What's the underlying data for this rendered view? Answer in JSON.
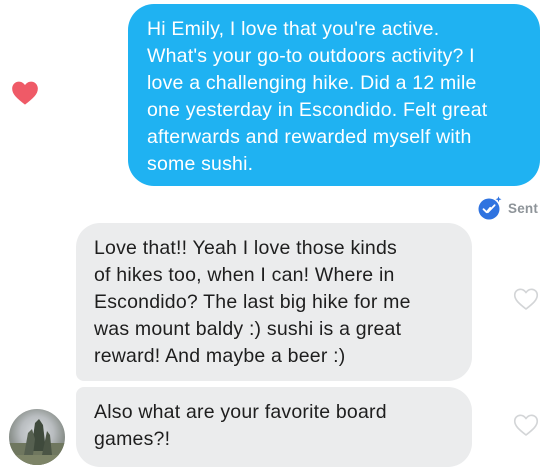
{
  "conversation": {
    "messages": [
      {
        "direction": "outgoing",
        "text": "Hi Emily, I love that you're active.\nWhat's your go-to outdoors activity? I\nlove a challenging hike. Did a 12 mile\none yesterday in Escondido. Felt great\nafterwards and rewarded myself with\nsome sushi.",
        "liked": true
      },
      {
        "direction": "incoming",
        "text": "Love that!! Yeah I love those kinds\nof hikes too, when I can! Where in\nEscondido? The last big hike for me\nwas mount baldy :) sushi is a great\nreward! And maybe a beer :)",
        "liked": false
      },
      {
        "direction": "incoming",
        "text": "Also what are your favorite board\ngames?!",
        "liked": false
      }
    ],
    "status": {
      "label": "Sent",
      "icon": "sent-check-icon"
    }
  },
  "icons": {
    "liked_heart": "heart-filled-icon",
    "like_button": "heart-outline-icon",
    "avatar": "profile-avatar"
  },
  "colors": {
    "outgoing_bubble": "#1fb2f2",
    "incoming_bubble": "#ebeced",
    "liked_heart": "#ef5a67",
    "sent_icon": "#2f73e0",
    "sent_label": "#8e9499"
  }
}
